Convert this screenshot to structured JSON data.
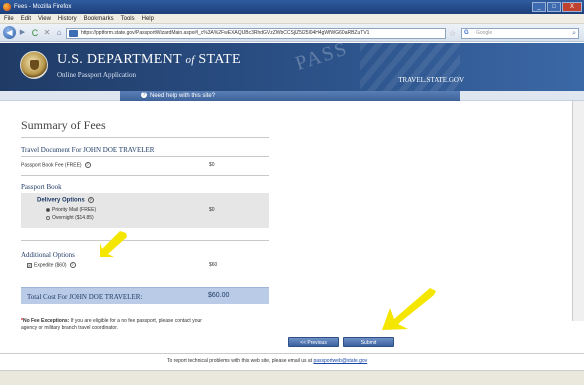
{
  "browser": {
    "window_title": "Fees - Mozilla Firefox",
    "menu": [
      "File",
      "Edit",
      "View",
      "History",
      "Bookmarks",
      "Tools",
      "Help"
    ],
    "url": "https://pptform.state.gov/PassportWizardMain.aspx#l_c%3A%2FwEXAQUBc3RhdGVzZWbCCSjlZ5l25l04H4gWfWG60aRBZuTV1",
    "search_placeholder": "Google",
    "search_engine_icon": "G",
    "window_buttons": [
      "_",
      "□",
      "X"
    ]
  },
  "header": {
    "title_main": "U.S. DEPARTMENT",
    "title_of": "of",
    "title_end": "STATE",
    "subtitle": "Online Passport Application",
    "watermark": "PASS",
    "travel_gov": "TRAVEL.STATE.GOV",
    "help_link": "Need help with this site?"
  },
  "summary": {
    "title": "Summary of Fees",
    "travel_document_heading": "Travel Document For JOHN DOE TRAVELER",
    "passport_book_fee_label": "Passport Book Fee (FREE)",
    "passport_book_fee_value": "$0",
    "passport_book_heading": "Passport Book",
    "delivery_options_label": "Delivery Options",
    "delivery_options": [
      {
        "label": "Priority Mail (FREE)",
        "selected": true
      },
      {
        "label": "Overnight ($14.85)",
        "selected": false
      }
    ],
    "delivery_value": "$0",
    "additional_options_heading": "Additional Options",
    "expedite_label": "Expedite ($60)",
    "expedite_checked": true,
    "expedite_value": "$60",
    "total_label": "Total Cost For JOHN DOE TRAVELER:",
    "total_value": "$60.00",
    "no_fee_asterisk": "*",
    "no_fee_bold": "No Fee Exceptions:",
    "no_fee_text_1": "If you are eligible for a no fee passport, please contact your",
    "no_fee_text_2": "agency or military branch travel coordinator."
  },
  "buttons": {
    "previous": "<< Previous",
    "submit": "Submit"
  },
  "footer": {
    "text": "To report technical problems with this web site, please email us at",
    "email": "passportweb@state.gov"
  },
  "colors": {
    "header_blue": "#1f3b66",
    "total_bar": "#b9cbe6",
    "annotation_arrow": "#f5e600"
  }
}
